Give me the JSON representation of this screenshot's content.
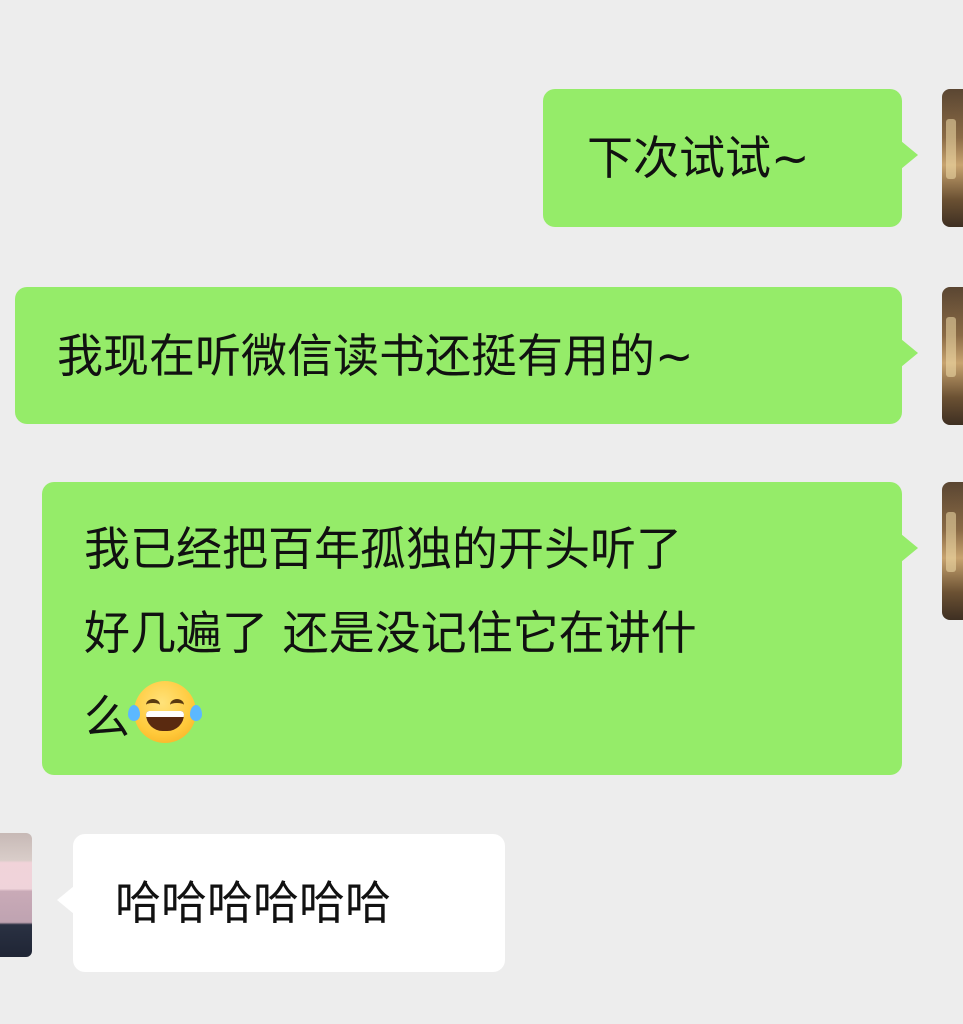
{
  "messages": [
    {
      "side": "sent",
      "lines": [
        "下次试试~"
      ]
    },
    {
      "side": "sent",
      "lines": [
        "我现在听微信读书还挺有用的~"
      ]
    },
    {
      "side": "sent",
      "lines": [
        "我已经把百年孤独的开头听了",
        "好几遍了 还是没记住它在讲什",
        "么"
      ],
      "emoji": "face-with-tears-of-joy"
    },
    {
      "side": "received",
      "lines": [
        "哈哈哈哈哈哈"
      ]
    }
  ],
  "colors": {
    "background": "#ededed",
    "sent_bubble": "#95ec69",
    "received_bubble": "#ffffff",
    "text": "#111111"
  }
}
